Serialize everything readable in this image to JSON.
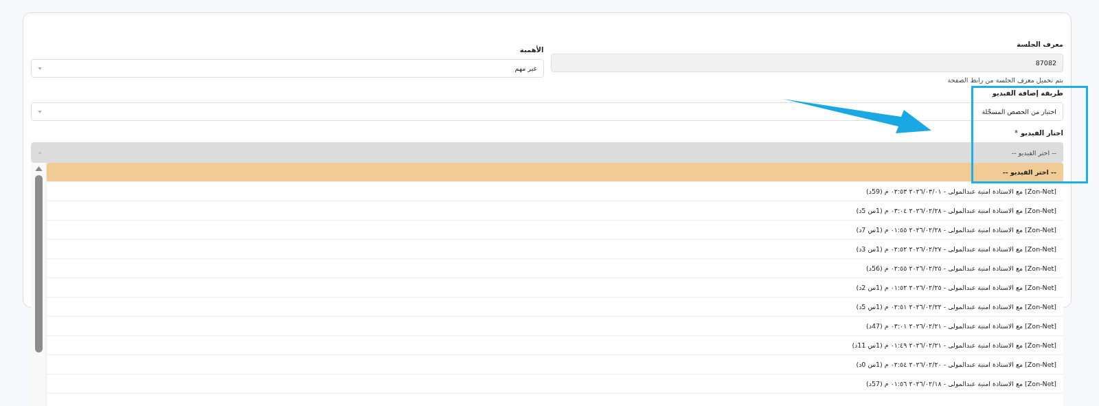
{
  "session_id": {
    "label": "معرف الجلسة",
    "value": "87082",
    "disabled": true,
    "hint": "يتم تحميل معرف الجلسة من رابط الصفحة"
  },
  "importance": {
    "label": "الأهمية",
    "value": "غير مهم"
  },
  "add_method": {
    "label": "طريقة إضافة الفيديو",
    "value": "اختيار من الحصص المسجّلة"
  },
  "video": {
    "label": "اختار الفيديو",
    "required_mark": "*",
    "value": "-- اختر الفيديو --",
    "expanded": true,
    "options": [
      {
        "label": "-- اختر الفيديو --",
        "selected": true
      },
      {
        "label": "[Zon-Net] مع الاستاذة امنية عبدالمولى - ٢٠٢٦/٠٣/٠١ ٠٢:٥٣ م (59د)",
        "selected": false
      },
      {
        "label": "[Zon-Net] مع الاستاذة امنية عبدالمولى - ٢٠٢٦/٠٢/٢٨ ٠٣:٠٤ م (1س 5د)",
        "selected": false
      },
      {
        "label": "[Zon-Net] مع الاستاذة امنية عبدالمولى - ٢٠٢٦/٠٢/٢٨ ٠١:٥٥ م (1س 7د)",
        "selected": false
      },
      {
        "label": "[Zon-Net] مع الاستاذة امنية عبدالمولى - ٢٠٢٦/٠٢/٢٧ ٠٢:٥٢ م (1س 3د)",
        "selected": false
      },
      {
        "label": "[Zon-Net] مع الاستاذة امنية عبدالمولى - ٢٠٢٦/٠٢/٢٥ ٠٢:٥٥ م (56د)",
        "selected": false
      },
      {
        "label": "[Zon-Net] مع الاستاذة امنية عبدالمولى - ٢٠٢٦/٠٢/٢٥ ٠١:٥٢ م (1س 2د)",
        "selected": false
      },
      {
        "label": "[Zon-Net] مع الاستاذة امنية عبدالمولى - ٢٠٢٦/٠٢/٢٢ ٠٢:٥١ م (1س 5د)",
        "selected": false
      },
      {
        "label": "[Zon-Net] مع الاستاذة امنية عبدالمولى - ٢٠٢٦/٠٢/٢١ ٠٣:٠١ م (47د)",
        "selected": false
      },
      {
        "label": "[Zon-Net] مع الاستاذة امنية عبدالمولى - ٢٠٢٦/٠٢/٢١ ٠١:٤٩ م (1س 11د)",
        "selected": false
      },
      {
        "label": "[Zon-Net] مع الاستاذة امنية عبدالمولى - ٢٠٢٦/٠٢/٢٠ ٠٢:٥٤ م (1س 0د)",
        "selected": false
      },
      {
        "label": "[Zon-Net] مع الاستاذة امنية عبدالمولى - ٢٠٢٦/٠٢/١٨ ٠١:٥٦ م (57د)",
        "selected": false
      }
    ]
  }
}
